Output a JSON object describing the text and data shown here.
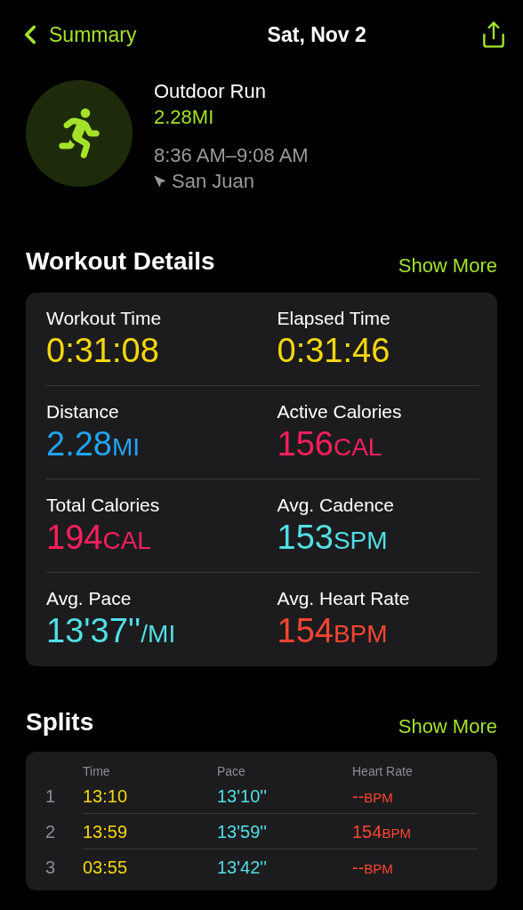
{
  "nav": {
    "back_label": "Summary",
    "title": "Sat, Nov 2"
  },
  "workout": {
    "type": "Outdoor Run",
    "distance": "2.28MI",
    "time_range": "8:36 AM–9:08 AM",
    "location": "San Juan"
  },
  "details": {
    "title": "Workout Details",
    "show_more": "Show More",
    "metrics": [
      {
        "label": "Workout Time",
        "value": "0:31:08",
        "color": "#f6d70b"
      },
      {
        "label": "Elapsed Time",
        "value": "0:31:46",
        "color": "#f6d70b"
      },
      {
        "label": "Distance",
        "value": "2.28",
        "unit": "MI",
        "color": "#22a3f5"
      },
      {
        "label": "Active Calories",
        "value": "156",
        "unit": "CAL",
        "color": "#fb1f5c"
      },
      {
        "label": "Total Calories",
        "value": "194",
        "unit": "CAL",
        "color": "#fb1f5c"
      },
      {
        "label": "Avg. Cadence",
        "value": "153",
        "unit": "SPM",
        "color": "#52dfe6"
      },
      {
        "label": "Avg. Pace",
        "value": "13'37''",
        "unit": "/MI",
        "color": "#52dfe6"
      },
      {
        "label": "Avg. Heart Rate",
        "value": "154",
        "unit": "BPM",
        "color": "#ff4530"
      }
    ]
  },
  "splits": {
    "title": "Splits",
    "show_more": "Show More",
    "columns": [
      "Time",
      "Pace",
      "Heart Rate"
    ],
    "rows": [
      {
        "index": "1",
        "time": "13:10",
        "pace": "13'10''",
        "heart_rate": "--",
        "unit": "BPM"
      },
      {
        "index": "2",
        "time": "13:59",
        "pace": "13'59''",
        "heart_rate": "154",
        "unit": "BPM"
      },
      {
        "index": "3",
        "time": "03:55",
        "pace": "13'42''",
        "heart_rate": "--",
        "unit": "BPM"
      }
    ]
  }
}
